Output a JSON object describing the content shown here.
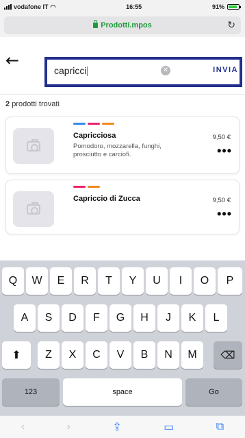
{
  "status_bar": {
    "carrier": "vodafone IT",
    "time": "16:55",
    "battery": "91%"
  },
  "address_bar": {
    "url": "Prodotti.mpos"
  },
  "search": {
    "value": "capricci",
    "send_label": "INVIA"
  },
  "results": {
    "count": "2",
    "label": "prodotti trovati"
  },
  "products": [
    {
      "name": "Capricciosa",
      "description": "Pomodoro, mozzarella, funghi, prosciutto e carciofi.",
      "price": "9,50 €",
      "tag_colors": [
        "#2f8cf0",
        "#e8246e",
        "#f08a1c"
      ]
    },
    {
      "name": "Capriccio di Zucca",
      "description": "",
      "price": "9,50 €",
      "tag_colors": [
        "#e8246e",
        "#f08a1c"
      ]
    }
  ],
  "keyboard": {
    "row1": [
      "Q",
      "W",
      "E",
      "R",
      "T",
      "Y",
      "U",
      "I",
      "O",
      "P"
    ],
    "row2": [
      "A",
      "S",
      "D",
      "F",
      "G",
      "H",
      "J",
      "K",
      "L"
    ],
    "row3": [
      "Z",
      "X",
      "C",
      "V",
      "B",
      "N",
      "M"
    ],
    "numbers_label": "123",
    "space_label": "space",
    "go_label": "Go"
  },
  "colors": {
    "accent": "#232f8e",
    "secure": "#1e9a3a"
  },
  "icons": [
    "back-arrow-icon",
    "lock-icon",
    "reload-icon",
    "clear-icon",
    "camera-icon",
    "more-icon",
    "shift-icon",
    "backspace-icon",
    "share-icon",
    "bookmarks-icon",
    "tabs-icon"
  ]
}
